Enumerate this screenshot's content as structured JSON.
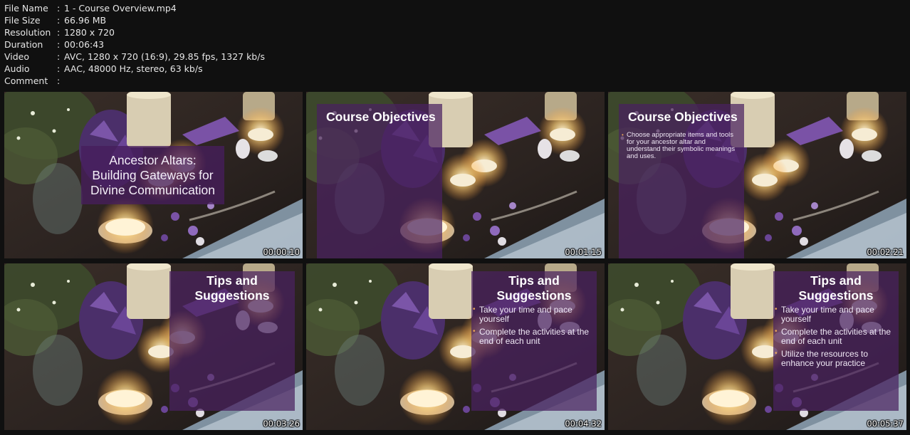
{
  "info": {
    "rows": [
      {
        "key": "File Name",
        "value": "1 - Course Overview.mp4"
      },
      {
        "key": "File Size",
        "value": "66.96 MB"
      },
      {
        "key": "Resolution",
        "value": "1280 x 720"
      },
      {
        "key": "Duration",
        "value": "00:06:43"
      },
      {
        "key": "Video",
        "value": "AVC, 1280 x 720 (16:9), 29.85 fps, 1327 kb/s"
      },
      {
        "key": "Audio",
        "value": "AAC, 48000 Hz, stereo, 63 kb/s"
      },
      {
        "key": "Comment",
        "value": ""
      }
    ],
    "separator": ":"
  },
  "thumbnails": [
    {
      "timestamp": "00:00:10",
      "title_lines": [
        "Ancestor Altars:",
        "Building Gateways for",
        "Divine Communication"
      ]
    },
    {
      "timestamp": "00:01:15",
      "heading": "Course Objectives"
    },
    {
      "timestamp": "00:02:21",
      "heading": "Course Objectives",
      "objective": "Choose appropriate items and tools for your ancestor altar and understand their symbolic meanings and uses."
    },
    {
      "timestamp": "00:03:26",
      "heading_lines": [
        "Tips and",
        "Suggestions"
      ]
    },
    {
      "timestamp": "00:04:32",
      "heading_lines": [
        "Tips and",
        "Suggestions"
      ],
      "tips": [
        "Take your time and pace yourself",
        "Complete the activities at the end of each unit"
      ]
    },
    {
      "timestamp": "00:05:37",
      "heading_lines": [
        "Tips and",
        "Suggestions"
      ],
      "tips": [
        "Take your time and pace yourself",
        "Complete the activities at the end of each unit",
        "Utilize the resources to enhance your practice"
      ]
    }
  ],
  "colors": {
    "panel_purple": "#4a2160",
    "bullet_orange": "#e8a45a",
    "background": "#101010"
  }
}
